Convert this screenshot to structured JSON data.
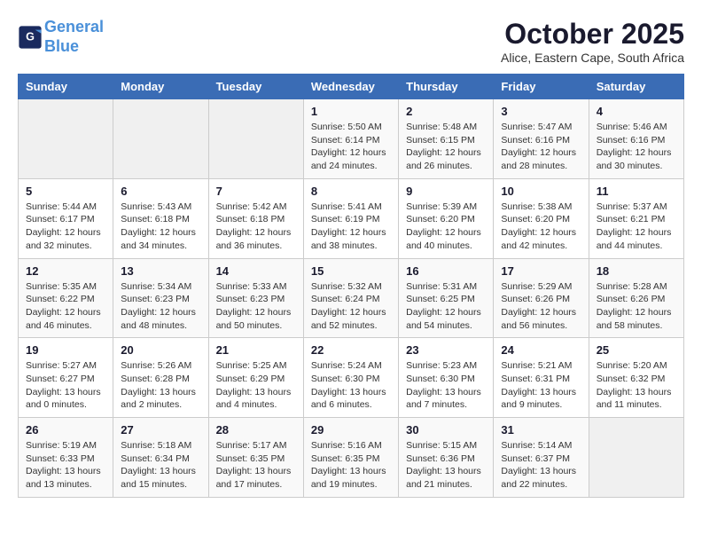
{
  "header": {
    "logo_line1": "General",
    "logo_line2": "Blue",
    "month": "October 2025",
    "location": "Alice, Eastern Cape, South Africa"
  },
  "weekdays": [
    "Sunday",
    "Monday",
    "Tuesday",
    "Wednesday",
    "Thursday",
    "Friday",
    "Saturday"
  ],
  "weeks": [
    [
      {
        "day": "",
        "info": ""
      },
      {
        "day": "",
        "info": ""
      },
      {
        "day": "",
        "info": ""
      },
      {
        "day": "1",
        "info": "Sunrise: 5:50 AM\nSunset: 6:14 PM\nDaylight: 12 hours\nand 24 minutes."
      },
      {
        "day": "2",
        "info": "Sunrise: 5:48 AM\nSunset: 6:15 PM\nDaylight: 12 hours\nand 26 minutes."
      },
      {
        "day": "3",
        "info": "Sunrise: 5:47 AM\nSunset: 6:16 PM\nDaylight: 12 hours\nand 28 minutes."
      },
      {
        "day": "4",
        "info": "Sunrise: 5:46 AM\nSunset: 6:16 PM\nDaylight: 12 hours\nand 30 minutes."
      }
    ],
    [
      {
        "day": "5",
        "info": "Sunrise: 5:44 AM\nSunset: 6:17 PM\nDaylight: 12 hours\nand 32 minutes."
      },
      {
        "day": "6",
        "info": "Sunrise: 5:43 AM\nSunset: 6:18 PM\nDaylight: 12 hours\nand 34 minutes."
      },
      {
        "day": "7",
        "info": "Sunrise: 5:42 AM\nSunset: 6:18 PM\nDaylight: 12 hours\nand 36 minutes."
      },
      {
        "day": "8",
        "info": "Sunrise: 5:41 AM\nSunset: 6:19 PM\nDaylight: 12 hours\nand 38 minutes."
      },
      {
        "day": "9",
        "info": "Sunrise: 5:39 AM\nSunset: 6:20 PM\nDaylight: 12 hours\nand 40 minutes."
      },
      {
        "day": "10",
        "info": "Sunrise: 5:38 AM\nSunset: 6:20 PM\nDaylight: 12 hours\nand 42 minutes."
      },
      {
        "day": "11",
        "info": "Sunrise: 5:37 AM\nSunset: 6:21 PM\nDaylight: 12 hours\nand 44 minutes."
      }
    ],
    [
      {
        "day": "12",
        "info": "Sunrise: 5:35 AM\nSunset: 6:22 PM\nDaylight: 12 hours\nand 46 minutes."
      },
      {
        "day": "13",
        "info": "Sunrise: 5:34 AM\nSunset: 6:23 PM\nDaylight: 12 hours\nand 48 minutes."
      },
      {
        "day": "14",
        "info": "Sunrise: 5:33 AM\nSunset: 6:23 PM\nDaylight: 12 hours\nand 50 minutes."
      },
      {
        "day": "15",
        "info": "Sunrise: 5:32 AM\nSunset: 6:24 PM\nDaylight: 12 hours\nand 52 minutes."
      },
      {
        "day": "16",
        "info": "Sunrise: 5:31 AM\nSunset: 6:25 PM\nDaylight: 12 hours\nand 54 minutes."
      },
      {
        "day": "17",
        "info": "Sunrise: 5:29 AM\nSunset: 6:26 PM\nDaylight: 12 hours\nand 56 minutes."
      },
      {
        "day": "18",
        "info": "Sunrise: 5:28 AM\nSunset: 6:26 PM\nDaylight: 12 hours\nand 58 minutes."
      }
    ],
    [
      {
        "day": "19",
        "info": "Sunrise: 5:27 AM\nSunset: 6:27 PM\nDaylight: 13 hours\nand 0 minutes."
      },
      {
        "day": "20",
        "info": "Sunrise: 5:26 AM\nSunset: 6:28 PM\nDaylight: 13 hours\nand 2 minutes."
      },
      {
        "day": "21",
        "info": "Sunrise: 5:25 AM\nSunset: 6:29 PM\nDaylight: 13 hours\nand 4 minutes."
      },
      {
        "day": "22",
        "info": "Sunrise: 5:24 AM\nSunset: 6:30 PM\nDaylight: 13 hours\nand 6 minutes."
      },
      {
        "day": "23",
        "info": "Sunrise: 5:23 AM\nSunset: 6:30 PM\nDaylight: 13 hours\nand 7 minutes."
      },
      {
        "day": "24",
        "info": "Sunrise: 5:21 AM\nSunset: 6:31 PM\nDaylight: 13 hours\nand 9 minutes."
      },
      {
        "day": "25",
        "info": "Sunrise: 5:20 AM\nSunset: 6:32 PM\nDaylight: 13 hours\nand 11 minutes."
      }
    ],
    [
      {
        "day": "26",
        "info": "Sunrise: 5:19 AM\nSunset: 6:33 PM\nDaylight: 13 hours\nand 13 minutes."
      },
      {
        "day": "27",
        "info": "Sunrise: 5:18 AM\nSunset: 6:34 PM\nDaylight: 13 hours\nand 15 minutes."
      },
      {
        "day": "28",
        "info": "Sunrise: 5:17 AM\nSunset: 6:35 PM\nDaylight: 13 hours\nand 17 minutes."
      },
      {
        "day": "29",
        "info": "Sunrise: 5:16 AM\nSunset: 6:35 PM\nDaylight: 13 hours\nand 19 minutes."
      },
      {
        "day": "30",
        "info": "Sunrise: 5:15 AM\nSunset: 6:36 PM\nDaylight: 13 hours\nand 21 minutes."
      },
      {
        "day": "31",
        "info": "Sunrise: 5:14 AM\nSunset: 6:37 PM\nDaylight: 13 hours\nand 22 minutes."
      },
      {
        "day": "",
        "info": ""
      }
    ]
  ]
}
